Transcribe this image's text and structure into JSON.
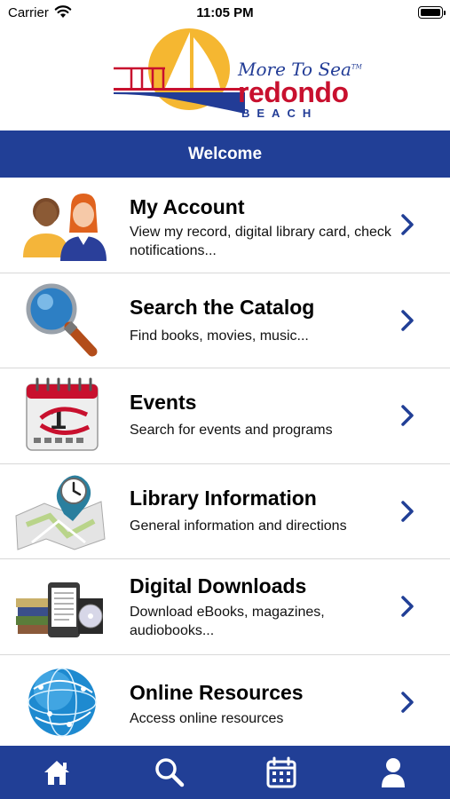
{
  "status_bar": {
    "carrier": "Carrier",
    "time": "11:05 PM",
    "icons": [
      "wifi-icon",
      "battery-icon"
    ]
  },
  "logo": {
    "tagline": "More To Sea",
    "trademark": "TM",
    "city": "redondo",
    "beach": "BEACH",
    "colors": {
      "sun": "#f5b731",
      "blue": "#223c96",
      "red": "#c8102e"
    }
  },
  "welcome": {
    "title": "Welcome"
  },
  "menu": {
    "items": [
      {
        "title": "My Account",
        "desc": "View my record, digital library card, check notifications...",
        "icon": "account-users-icon"
      },
      {
        "title": "Search the Catalog",
        "desc": "Find books, movies, music...",
        "icon": "magnifier-icon"
      },
      {
        "title": "Events",
        "desc": "Search for events and programs",
        "icon": "calendar-icon"
      },
      {
        "title": "Library Information",
        "desc": "General information and directions",
        "icon": "map-clock-icon"
      },
      {
        "title": "Digital Downloads",
        "desc": "Download eBooks, magazines, audiobooks...",
        "icon": "ereader-books-icon"
      },
      {
        "title": "Online Resources",
        "desc": "Access online resources",
        "icon": "globe-icon"
      }
    ]
  },
  "tab_bar": {
    "tabs": [
      "home-icon",
      "search-icon",
      "calendar-icon",
      "person-icon"
    ]
  },
  "colors": {
    "brand_blue": "#213f96",
    "chevron_blue": "#213f96",
    "divider": "#d8d8d8"
  }
}
